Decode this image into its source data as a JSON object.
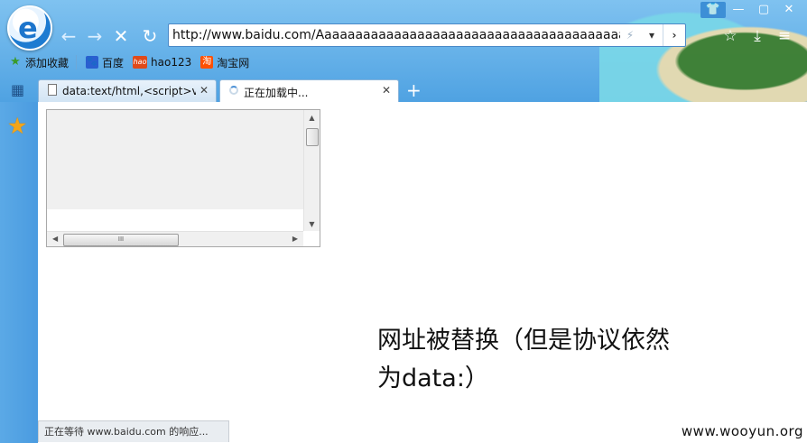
{
  "browser": {
    "logo_letter": "e",
    "nav": {
      "back_icon": "←",
      "forward_icon": "→",
      "stop_icon": "✕",
      "refresh_icon": "↻"
    },
    "url": "http://www.baidu.com/Aaaaaaaaaaaaaaaaaaaaaaaaaaaaaaaaaaaaaaaaaaaaaaaaaaaa",
    "url_tools": {
      "lightning": "⚡",
      "dropdown": "▾",
      "go": "›"
    },
    "window_controls": {
      "skin": "👕",
      "minimize": "—",
      "maximize": "▢",
      "close": "✕"
    },
    "right_tools": {
      "favorite": "☆",
      "download": "⤓",
      "menu": "≡"
    }
  },
  "bookmarks": [
    {
      "label": "添加收藏",
      "icon": "star-add-icon",
      "color": "#3a9a2a"
    },
    {
      "label": "百度",
      "icon": "baidu-paw-icon",
      "color": "#2a5fd0"
    },
    {
      "label": "hao123",
      "icon": "hao123-icon",
      "color": "#e04a1a"
    },
    {
      "label": "淘宝网",
      "icon": "taobao-icon",
      "color": "#ff5000"
    }
  ],
  "tabs": [
    {
      "label": "data:text/html,<script>var k",
      "close": "✕",
      "active": false
    },
    {
      "label": "正在加载中...",
      "close": "✕",
      "active": true
    }
  ],
  "new_tab": "+",
  "sidebar": {
    "star": "★"
  },
  "textarea": {
    "h_thumb_grip": "III"
  },
  "content": {
    "note_line1": "网址被替换（但是协议依然",
    "note_line2": "为data:）"
  },
  "status_bar": "正在等待 www.baidu.com 的响应...",
  "watermark": "www.wooyun.org",
  "colors": {
    "chrome_top": "#7fc2f0",
    "chrome_bottom": "#4fa2e2",
    "sidebar": "#4a9be0",
    "star": "#f3a51a"
  }
}
